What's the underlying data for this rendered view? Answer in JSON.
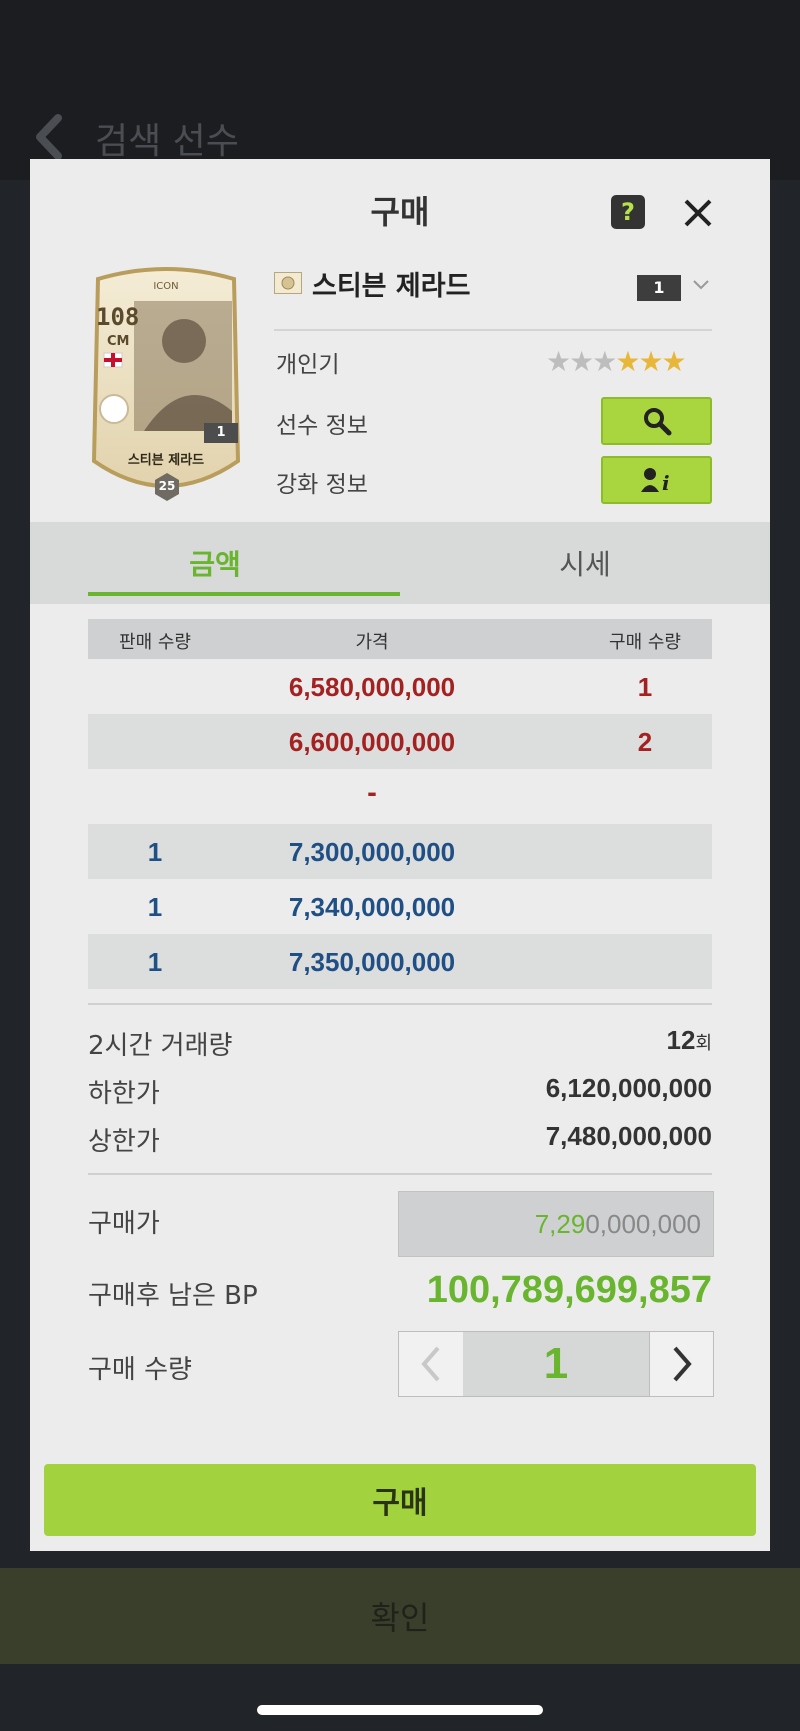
{
  "background": {
    "page_title": "검색 선수",
    "confirm_label": "확인"
  },
  "modal": {
    "title": "구매",
    "help_glyph": "?"
  },
  "card": {
    "ovr": "108",
    "position": "CM",
    "type_label": "ICON",
    "name": "스티븐 제라드",
    "enhance_level": "1",
    "season": "25"
  },
  "player": {
    "name": "스티븐 제라드",
    "selected_level": "1",
    "popularity_label": "개인기",
    "popularity_stars": 3,
    "popularity_max": 6,
    "player_info_label": "선수 정보",
    "enhance_info_label": "강화 정보"
  },
  "tabs": [
    {
      "label": "금액",
      "active": true
    },
    {
      "label": "시세",
      "active": false
    }
  ],
  "orders": {
    "headers": {
      "sell_qty": "판매 수량",
      "price": "가격",
      "buy_qty": "구매 수량"
    },
    "buy_orders": [
      {
        "price": "6,580,000,000",
        "buy_qty": "1"
      },
      {
        "price": "6,600,000,000",
        "buy_qty": "2"
      }
    ],
    "divider": "-",
    "sell_orders": [
      {
        "sell_qty": "1",
        "price": "7,300,000,000"
      },
      {
        "sell_qty": "1",
        "price": "7,340,000,000"
      },
      {
        "sell_qty": "1",
        "price": "7,350,000,000"
      }
    ]
  },
  "stats": {
    "volume_label": "2시간 거래량",
    "volume_value": "12",
    "volume_unit": "회",
    "min_label": "하한가",
    "min_value": "6,120,000,000",
    "max_label": "상한가",
    "max_value": "7,480,000,000"
  },
  "purchase": {
    "price_label": "구매가",
    "price_entered": "7,29",
    "price_rest": "0,000,000",
    "remaining_label": "구매후 남은 BP",
    "remaining_value": "100,789,699,857",
    "qty_label": "구매 수량",
    "qty_value": "1",
    "buy_button": "구매"
  },
  "colors": {
    "accent_green": "#6ab52f",
    "button_green": "#a2d23d",
    "buy_order_red": "#a32121",
    "sell_order_blue": "#1f4f85"
  }
}
